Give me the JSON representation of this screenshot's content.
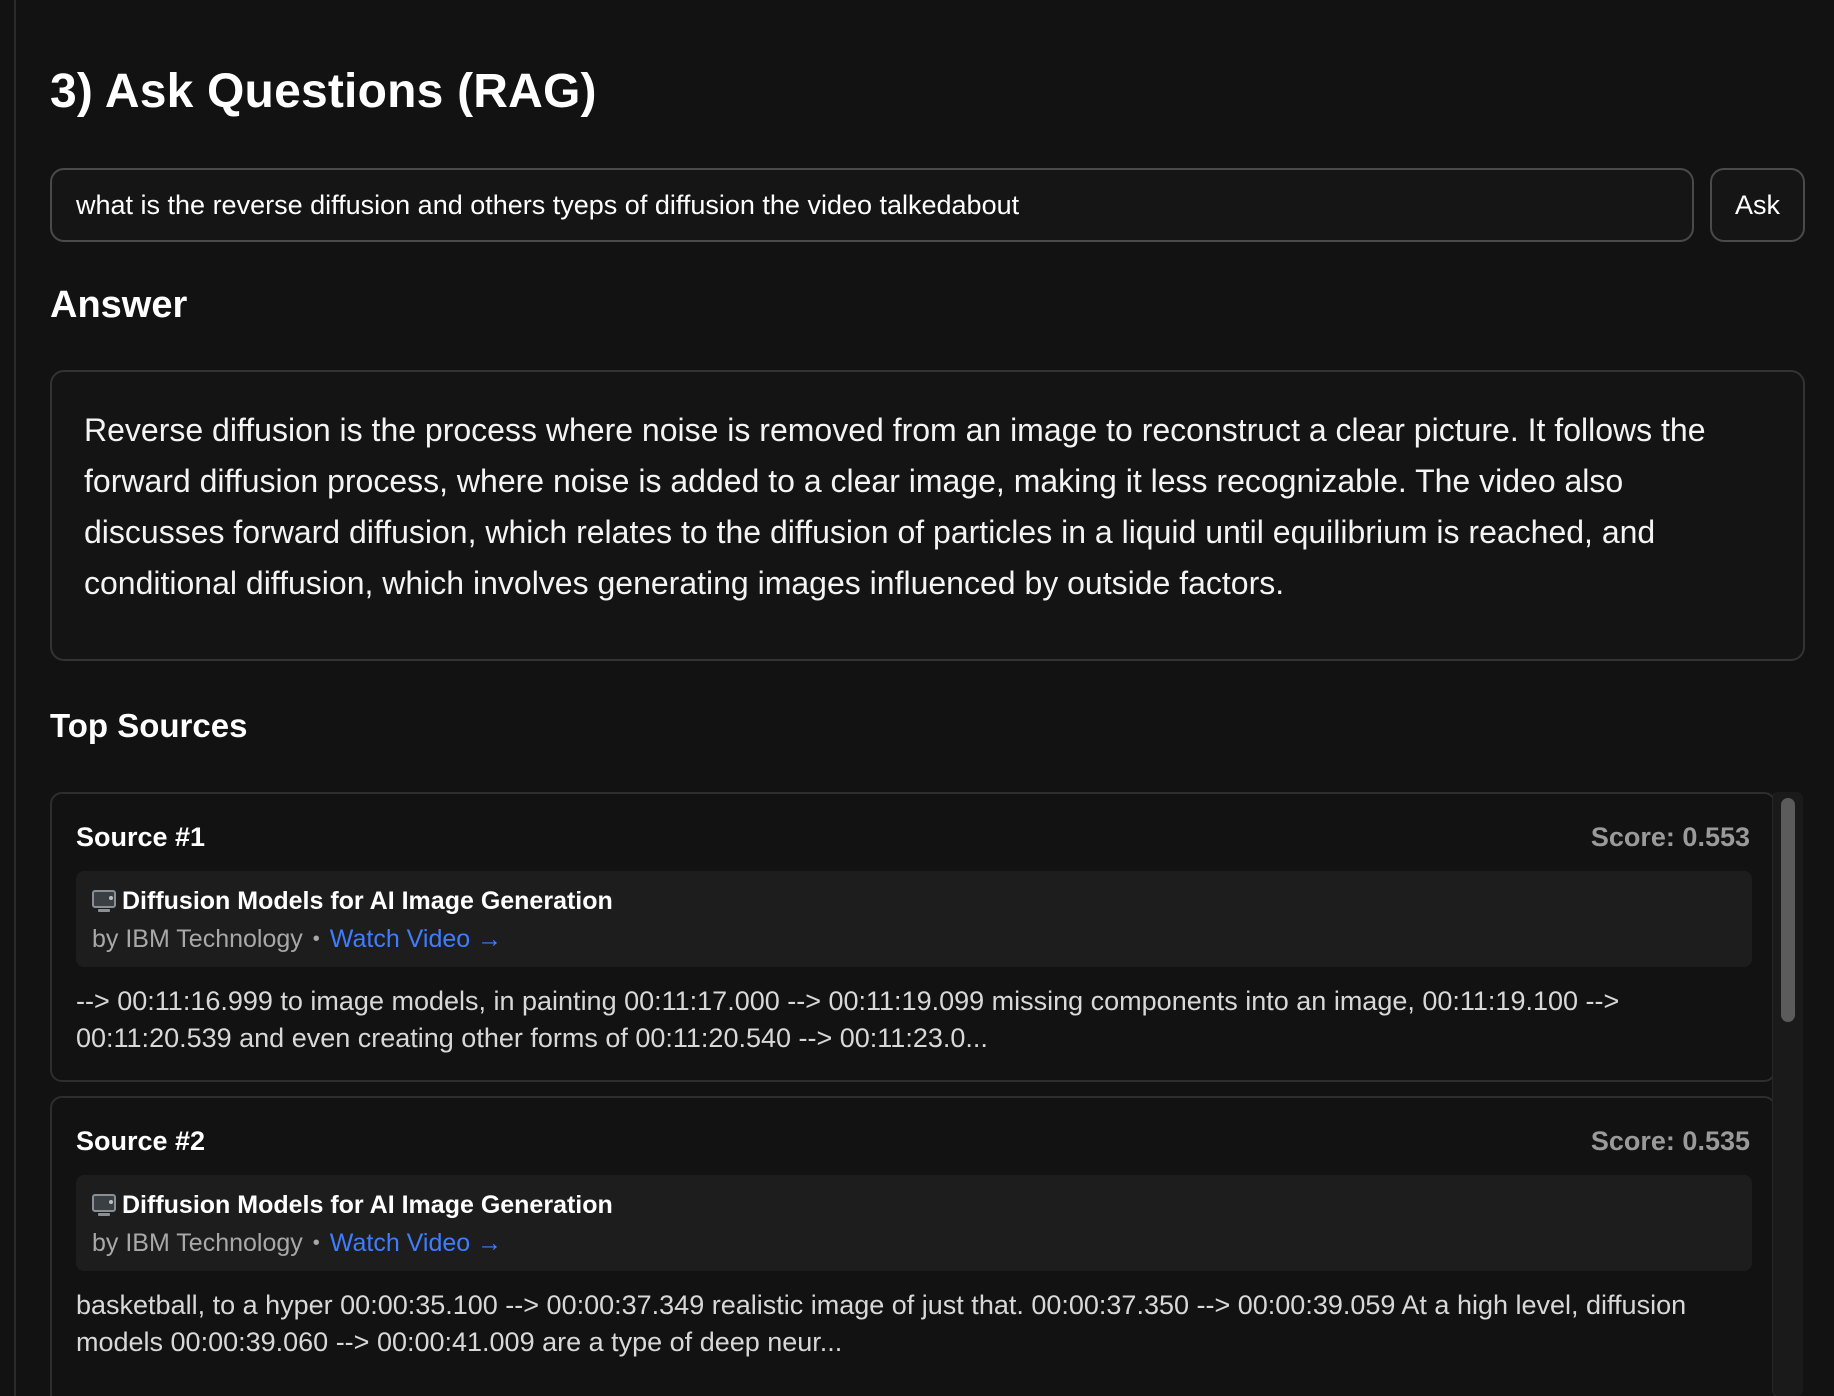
{
  "section": {
    "title": "3) Ask Questions (RAG)"
  },
  "ask": {
    "question_value": "what is the reverse diffusion and others tyeps of diffusion the video talkedabout",
    "button_label": "Ask"
  },
  "answer": {
    "heading": "Answer",
    "text": "Reverse diffusion is the process where noise is removed from an image to reconstruct a clear picture. It follows the forward diffusion process, where noise is added to a clear image, making it less recognizable. The video also discusses forward diffusion, which relates to the diffusion of particles in a liquid until equilibrium is reached, and conditional diffusion, which involves generating images influenced by outside factors."
  },
  "sources": {
    "heading": "Top Sources",
    "items": [
      {
        "label": "Source #1",
        "score": "Score: 0.553",
        "icon": "television-icon",
        "video_title": "Diffusion Models for AI Image Generation",
        "author": "by IBM Technology",
        "separator": "•",
        "link_label": "Watch Video →",
        "snippet": "--> 00:11:16.999 to image models, in painting 00:11:17.000 --> 00:11:19.099 missing components into an image, 00:11:19.100 --> 00:11:20.539 and even creating other forms of 00:11:20.540 --> 00:11:23.0..."
      },
      {
        "label": "Source #2",
        "score": "Score: 0.535",
        "icon": "television-icon",
        "video_title": "Diffusion Models for AI Image Generation",
        "author": "by IBM Technology",
        "separator": "•",
        "link_label": "Watch Video →",
        "snippet": "basketball, to a hyper 00:00:35.100 --> 00:00:37.349 realistic image of just that. 00:00:37.350 --> 00:00:39.059 At a high level, diffusion models 00:00:39.060 --> 00:00:41.009 are a type of deep neur..."
      }
    ]
  },
  "colors": {
    "background": "#121212",
    "link": "#3f7dff",
    "score_text": "#9a9a9a"
  }
}
